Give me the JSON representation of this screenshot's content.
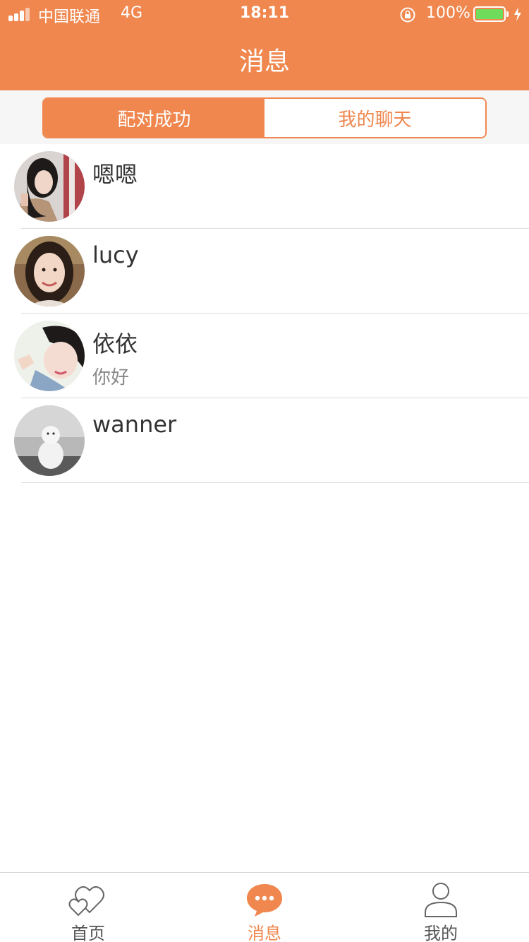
{
  "colors": {
    "accent": "#ef874f",
    "battery_green": "#6fdc5b"
  },
  "status_bar": {
    "carrier": "中国联通",
    "network": "4G",
    "time": "18:11",
    "battery_percent": "100%"
  },
  "nav": {
    "title": "消息"
  },
  "segment": {
    "tabs": [
      {
        "label": "配对成功",
        "active": true
      },
      {
        "label": "我的聊天",
        "active": false
      }
    ]
  },
  "chats": [
    {
      "name": "嗯嗯",
      "preview": "",
      "avatar": "avatar-woman-dark-hair"
    },
    {
      "name": "lucy",
      "preview": "",
      "avatar": "avatar-woman-smiling"
    },
    {
      "name": "依依",
      "preview": "你好",
      "avatar": "avatar-woman-peace-sign"
    },
    {
      "name": "wanner",
      "preview": "",
      "avatar": "avatar-snowman"
    }
  ],
  "tab_bar": {
    "tabs": [
      {
        "label": "首页",
        "icon": "hearts-icon",
        "active": false
      },
      {
        "label": "消息",
        "icon": "chat-bubble-icon",
        "active": true
      },
      {
        "label": "我的",
        "icon": "person-icon",
        "active": false
      }
    ]
  }
}
